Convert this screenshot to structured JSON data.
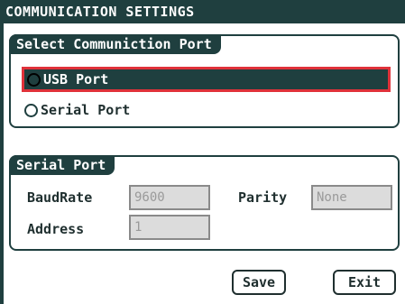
{
  "window": {
    "title": "COMMUNICATION SETTINGS"
  },
  "port_group": {
    "label": "Select Communiction Port",
    "options": [
      {
        "label": "USB Port",
        "selected": true
      },
      {
        "label": "Serial Port",
        "selected": false
      }
    ]
  },
  "serial_group": {
    "label": "Serial Port",
    "baudrate_label": "BaudRate",
    "baudrate_value": "9600",
    "parity_label": "Parity",
    "parity_value": "None",
    "address_label": "Address",
    "address_value": "1"
  },
  "buttons": {
    "save": "Save",
    "exit": "Exit"
  },
  "colors": {
    "accent": "#1f3f3f",
    "selection_border": "#e0323a",
    "disabled_field": "#dcdcdc"
  }
}
